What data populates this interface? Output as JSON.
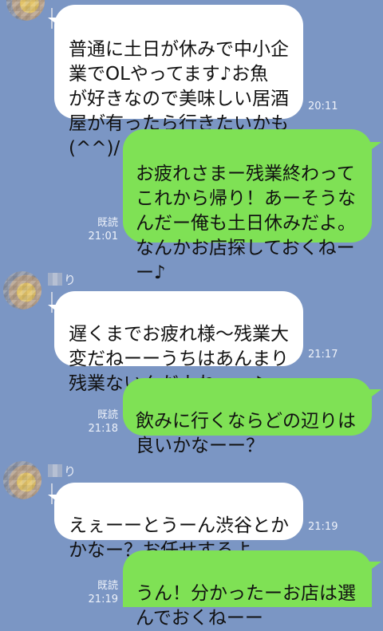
{
  "colors": {
    "background": "#7b96c4",
    "incoming_bubble": "#ffffff",
    "outgoing_bubble": "#7fe155",
    "meta_text": "#eef2fa"
  },
  "messages": [
    {
      "direction": "incoming",
      "text": "普通に土日が休みで中小企\n業でOLやってます♪お魚\nが好きなので美味しい居酒\n屋が有ったら行きたいかも\n(^^)/",
      "time": "20:11"
    },
    {
      "direction": "outgoing",
      "text": "お疲れさまー残業終わって\nこれから帰り！あーそうな\nんだー俺も土日休みだよ。\nなんかお店探しておくねー\nー♪",
      "read": "既読",
      "time": "21:01"
    },
    {
      "direction": "incoming",
      "sender_suffix": "り",
      "text": "遅くまでお疲れ様〜残業大\n変だねーーうちはあんまり\n残業ないんだよねーー♪",
      "time": "21:17"
    },
    {
      "direction": "outgoing",
      "text": "飲みに行くならどの辺りは\n良いかなーー？",
      "read": "既読",
      "time": "21:18"
    },
    {
      "direction": "incoming",
      "sender_suffix": "り",
      "text": "えぇーーとうーん渋谷とか\nかなー？お任せするよ",
      "time": "21:19"
    },
    {
      "direction": "outgoing",
      "text": "うん！分かったーお店は選\nんでおくねーー",
      "read": "既読",
      "time": "21:19"
    }
  ]
}
